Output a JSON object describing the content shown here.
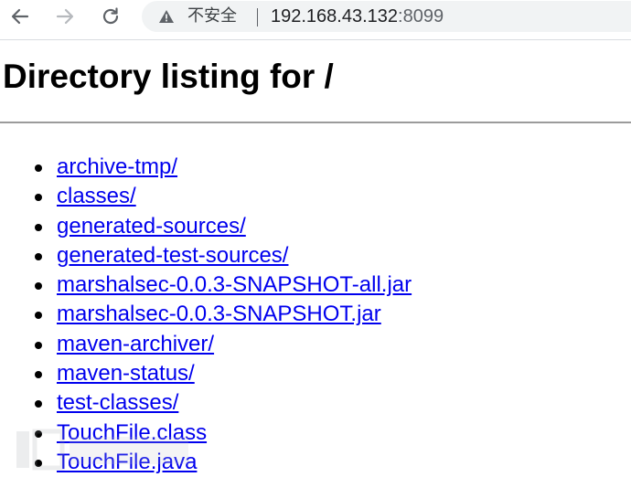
{
  "browser": {
    "security_label": "不安全",
    "url_host": "192.168.43.132",
    "url_port": ":8099"
  },
  "page": {
    "heading": "Directory listing for /",
    "entries": [
      "archive-tmp/",
      "classes/",
      "generated-sources/",
      "generated-test-sources/",
      "marshalsec-0.0.3-SNAPSHOT-all.jar",
      "marshalsec-0.0.3-SNAPSHOT.jar",
      "maven-archiver/",
      "maven-status/",
      "test-classes/",
      "TouchFile.class",
      "TouchFile.java"
    ]
  },
  "colors": {
    "link": "#0000ee",
    "omnibox_bg": "#f1f3f4"
  },
  "icons": {
    "back": "arrow-left-icon",
    "forward": "arrow-right-icon",
    "reload": "reload-icon",
    "security": "warning-triangle-icon"
  }
}
